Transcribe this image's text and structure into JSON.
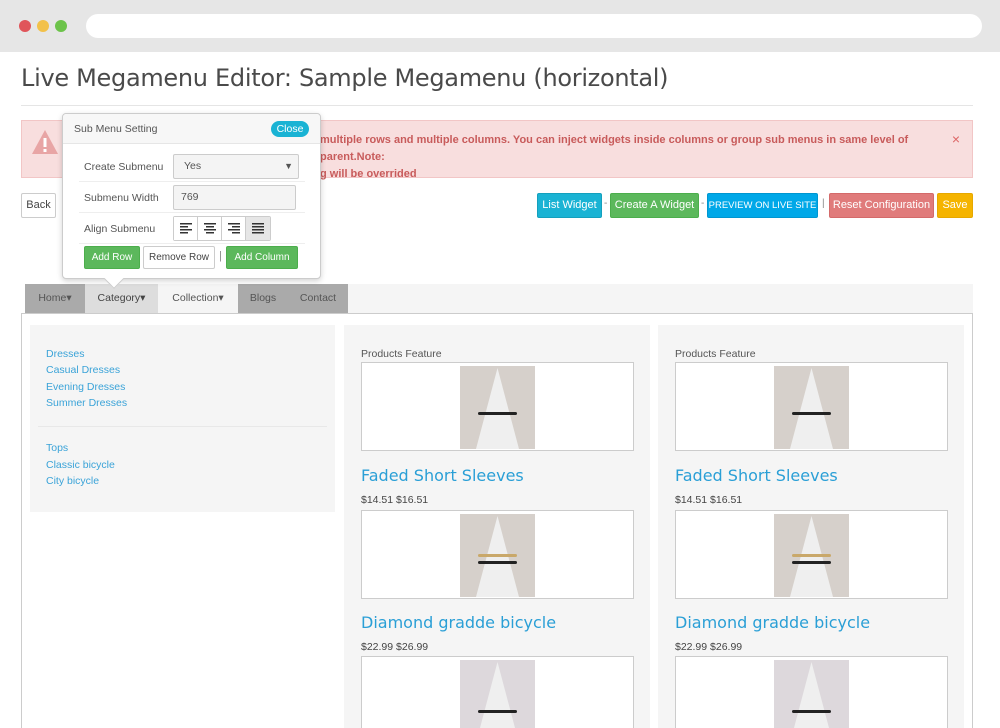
{
  "window": {
    "title": "Live Megamenu Editor: Sample Megamenu (horizontal)"
  },
  "alert": {
    "text": "multiple rows and multiple columns. You can inject widgets inside columns or group sub menus in same level of parent.Note: ",
    "text2": "g will be overrided",
    "close": "×"
  },
  "toolbar": {
    "back": "Back",
    "list_widget": "List Widget",
    "create_widget": "Create A Widget",
    "preview": "PREVIEW ON LIVE SITE",
    "reset": "Reset Configuration",
    "save": "Save",
    "sep": "-",
    "pipe": "|"
  },
  "popover": {
    "title": "Sub Menu Setting",
    "close": "Close",
    "create_submenu_label": "Create Submenu",
    "create_submenu_value": "Yes",
    "submenu_width_label": "Submenu Width",
    "submenu_width_value": "769",
    "align_label": "Align Submenu",
    "add_row": "Add Row",
    "remove_row": "Remove Row",
    "pipe": "|",
    "add_column": "Add Column"
  },
  "menu": {
    "home": "Home",
    "category": "Category",
    "collection": "Collection",
    "blogs": "Blogs",
    "contact": "Contact"
  },
  "submenu_links": {
    "group1": [
      "Dresses",
      "Casual Dresses",
      "Evening Dresses",
      "Summer Dresses"
    ],
    "group2": [
      "Tops",
      "Classic bicycle",
      "City bicycle"
    ]
  },
  "products": {
    "feature_label": "Products Feature",
    "items": [
      {
        "name": "Faded Short Sleeves",
        "price": "$14.51 $16.51"
      },
      {
        "name": "Diamond gradde bicycle",
        "price": "$22.99 $26.99"
      }
    ]
  },
  "colors": {
    "accent_blue": "#1ab3d4",
    "green": "#5cb85c",
    "danger": "#e07b7b",
    "warning": "#f5b400",
    "link": "#3aa3d8"
  }
}
